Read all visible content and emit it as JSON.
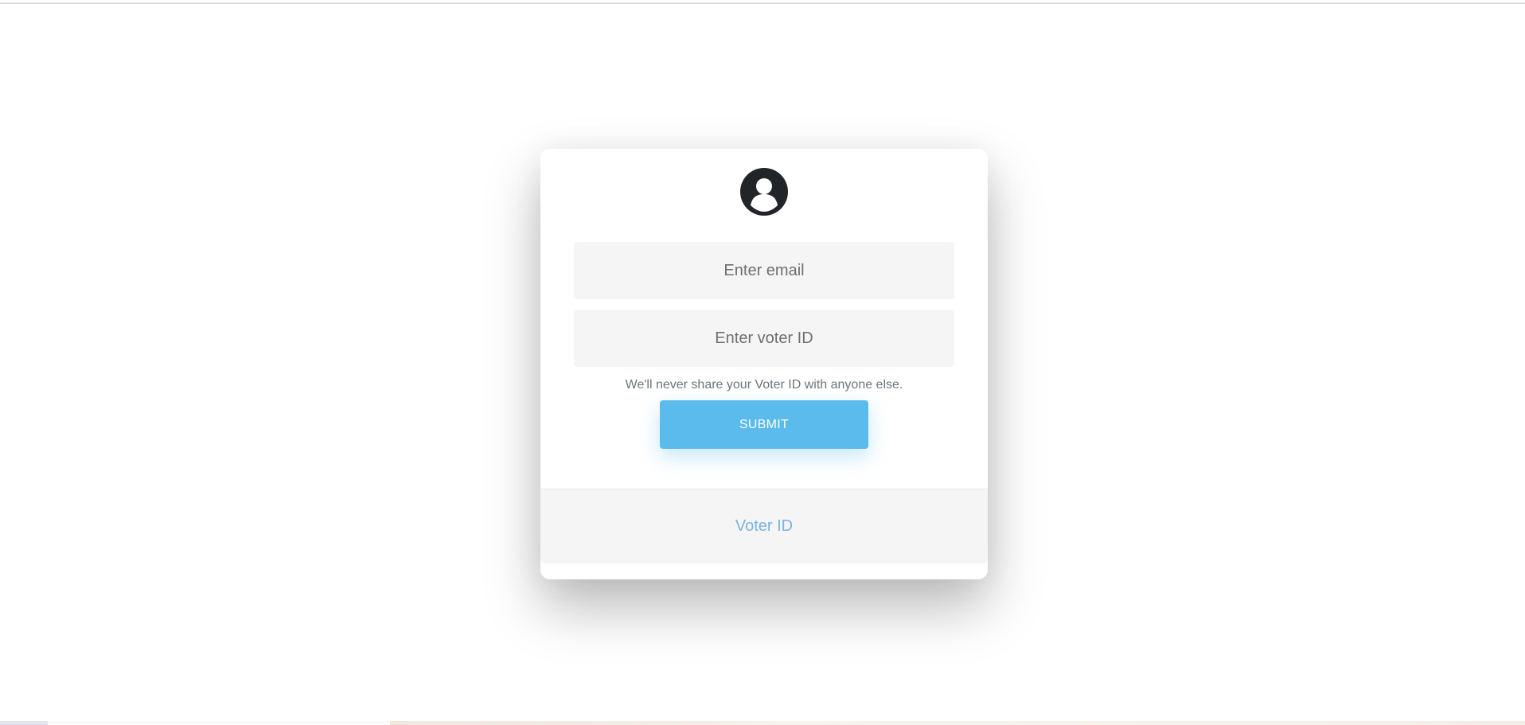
{
  "form": {
    "avatar_icon": "user-circle-icon",
    "email_placeholder": "Enter email",
    "voter_id_placeholder": "Enter voter ID",
    "help_text": "We'll never share your Voter ID with anyone else.",
    "submit_label": "SUBMIT"
  },
  "footer": {
    "text": "Voter ID"
  },
  "colors": {
    "accent": "#5bbbec",
    "footer_text": "#7ab3e0",
    "field_background": "#f5f5f5"
  }
}
